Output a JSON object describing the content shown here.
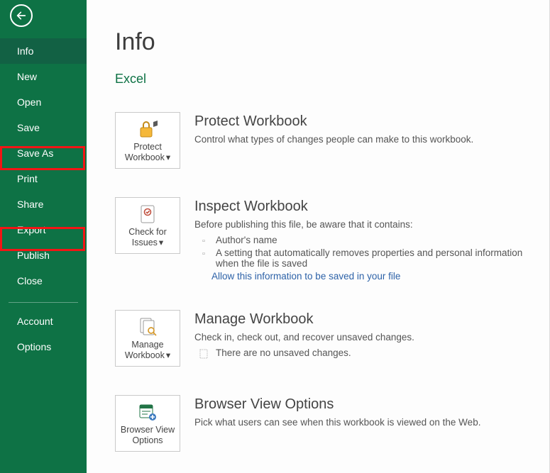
{
  "sidebar": {
    "items": [
      {
        "id": "info",
        "label": "Info",
        "active": true
      },
      {
        "id": "new",
        "label": "New"
      },
      {
        "id": "open",
        "label": "Open"
      },
      {
        "id": "save",
        "label": "Save"
      },
      {
        "id": "saveas",
        "label": "Save As",
        "highlight": true
      },
      {
        "id": "print",
        "label": "Print"
      },
      {
        "id": "share",
        "label": "Share"
      },
      {
        "id": "export",
        "label": "Export",
        "highlight": true
      },
      {
        "id": "publish",
        "label": "Publish"
      },
      {
        "id": "close",
        "label": "Close"
      }
    ],
    "footer": [
      {
        "id": "account",
        "label": "Account"
      },
      {
        "id": "options",
        "label": "Options"
      }
    ]
  },
  "page": {
    "title": "Info",
    "subtitle": "Excel"
  },
  "sections": {
    "protect": {
      "tile_label": "Protect Workbook",
      "has_dropdown": true,
      "heading": "Protect Workbook",
      "desc": "Control what types of changes people can make to this workbook."
    },
    "inspect": {
      "tile_label": "Check for Issues",
      "has_dropdown": true,
      "heading": "Inspect Workbook",
      "desc": "Before publishing this file, be aware that it contains:",
      "bullets": [
        "Author's name",
        "A setting that automatically removes properties and personal information when the file is saved"
      ],
      "link": "Allow this information to be saved in your file"
    },
    "manage": {
      "tile_label": "Manage Workbook",
      "has_dropdown": true,
      "heading": "Manage Workbook",
      "desc": "Check in, check out, and recover unsaved changes.",
      "status": "There are no unsaved changes."
    },
    "browser": {
      "tile_label": "Browser View Options",
      "has_dropdown": false,
      "heading": "Browser View Options",
      "desc": "Pick what users can see when this workbook is viewed on the Web."
    }
  }
}
